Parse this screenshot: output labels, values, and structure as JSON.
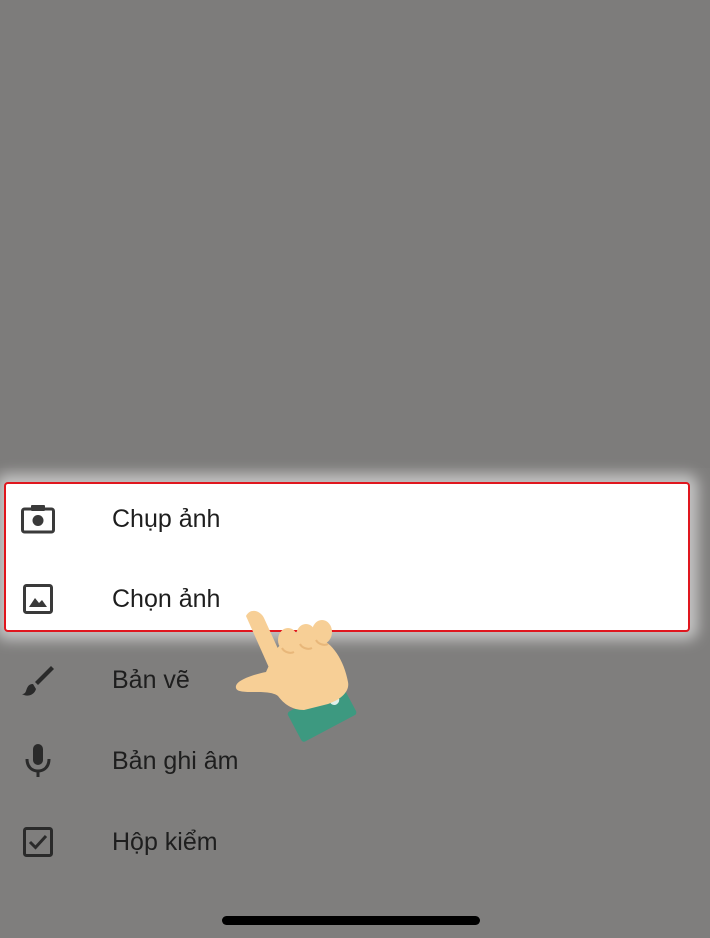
{
  "menu": {
    "items": [
      {
        "label": "Chụp ảnh",
        "icon": "camera-icon"
      },
      {
        "label": "Chọn ảnh",
        "icon": "image-icon"
      },
      {
        "label": "Bản vẽ",
        "icon": "brush-icon"
      },
      {
        "label": "Bản ghi âm",
        "icon": "microphone-icon"
      },
      {
        "label": "Hộp kiểm",
        "icon": "checkbox-icon"
      }
    ]
  },
  "colors": {
    "backdrop": "#7d7c7b",
    "highlight_border": "#e0161e",
    "hand_skin": "#f7cf96",
    "hand_cuff": "#3d9980"
  }
}
